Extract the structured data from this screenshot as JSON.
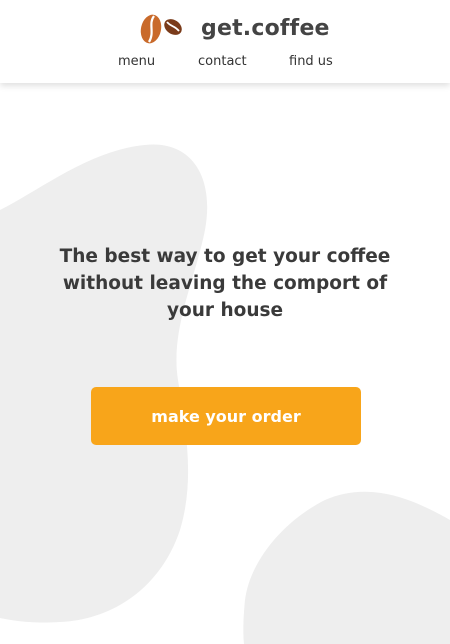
{
  "header": {
    "brand_name": "get.coffee",
    "logo_icon": "coffee-beans-icon",
    "nav": [
      {
        "label": "menu"
      },
      {
        "label": "contact"
      },
      {
        "label": "find us"
      }
    ]
  },
  "hero": {
    "headline": "The best way to get your coffee without leaving the comport of your house",
    "cta_label": "make your order"
  },
  "colors": {
    "accent": "#f8a51a",
    "bean_light": "#c96a2b",
    "bean_dark": "#7a3b1a",
    "blob": "#eeeeee",
    "text": "#3a3a3a"
  }
}
